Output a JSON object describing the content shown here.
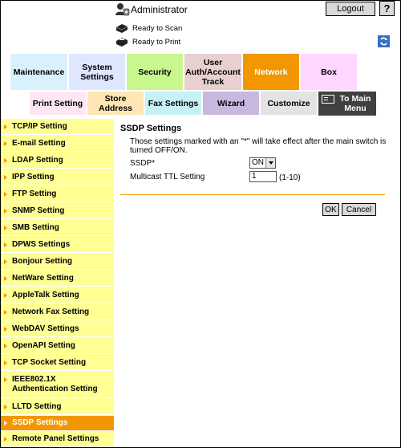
{
  "header": {
    "user": "Administrator",
    "logout_label": "Logout",
    "help_label": "?"
  },
  "status": {
    "scan": "Ready to Scan",
    "print": "Ready to Print"
  },
  "tabs_row1": [
    "Maintenance",
    "System Settings",
    "Security",
    "User Auth/Account Track",
    "Network",
    "Box"
  ],
  "tabs_row2": [
    "Print Setting",
    "Store Address",
    "Fax Settings",
    "Wizard",
    "Customize",
    "To Main Menu"
  ],
  "sidebar": {
    "items": [
      "TCP/IP Setting",
      "E-mail Setting",
      "LDAP Setting",
      "IPP Setting",
      "FTP Setting",
      "SNMP Setting",
      "SMB Setting",
      "DPWS Settings",
      "Bonjour Setting",
      "NetWare Setting",
      "AppleTalk Setting",
      "Network Fax Setting",
      "WebDAV Settings",
      "OpenAPI Setting",
      "TCP Socket Setting",
      "IEEE802.1X Authentication Setting",
      "LLTD Setting",
      "SSDP Settings",
      "Remote Panel Settings"
    ],
    "active": "SSDP Settings"
  },
  "content": {
    "title": "SSDP Settings",
    "note": "Those settings marked with an \"*\" will take effect after the main switch is turned OFF/ON.",
    "ssdp_label": "SSDP*",
    "ssdp_value": "ON",
    "ttl_label": "Multicast TTL Setting",
    "ttl_value": "1",
    "ttl_range": "(1-10)",
    "ok_label": "OK",
    "cancel_label": "Cancel"
  },
  "colors": {
    "accent": "#f29700",
    "menu_bg": "#ffff94"
  }
}
